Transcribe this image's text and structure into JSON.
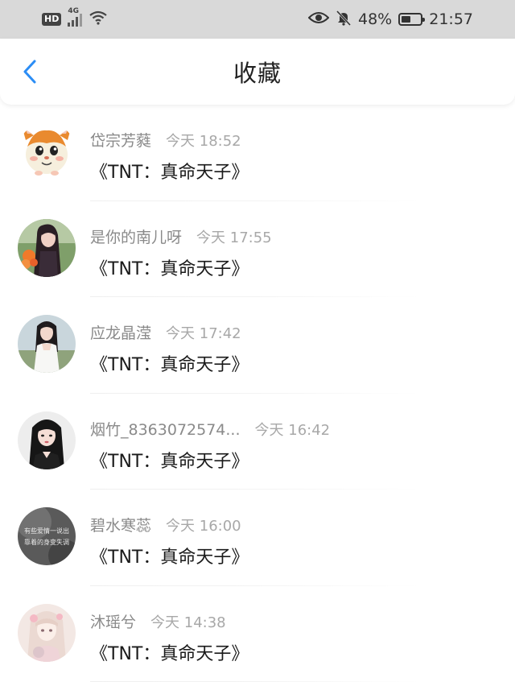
{
  "status_bar": {
    "hd_label": "HD",
    "network_label": "4G",
    "battery_percent": "48%",
    "battery_level": 0.48,
    "time": "21:57",
    "icons": [
      "hd-icon",
      "signal-icon",
      "wifi-icon",
      "eye-icon",
      "bell-muted-icon",
      "battery-icon"
    ]
  },
  "header": {
    "title": "收藏",
    "back_icon": "chevron-left-icon",
    "accent_color": "#2b8df5"
  },
  "favorites": [
    {
      "nickname": "岱宗芳蕤",
      "time": "今天 18:52",
      "message": "《TNT：真命天子》",
      "avatar": "hamster-cartoon"
    },
    {
      "nickname": "是你的南儿呀",
      "time": "今天 17:55",
      "message": "《TNT：真命天子》",
      "avatar": "girl-portrait"
    },
    {
      "nickname": "应龙晶滢",
      "time": "今天 17:42",
      "message": "《TNT：真命天子》",
      "avatar": "girl-portrait"
    },
    {
      "nickname": "烟竹_8363072574...",
      "time": "今天 16:42",
      "message": "《TNT：真命天子》",
      "avatar": "girl-portrait"
    },
    {
      "nickname": "碧水寒蕊",
      "time": "今天 16:00",
      "message": "《TNT：真命天子》",
      "avatar": "text-image"
    },
    {
      "nickname": "沐瑶兮",
      "time": "今天 14:38",
      "message": "《TNT：真命天子》",
      "avatar": "illustrated-girl"
    }
  ],
  "avatar_text": {
    "line1": "有些爱情一说出",
    "line2": "靠着的身变失调"
  }
}
